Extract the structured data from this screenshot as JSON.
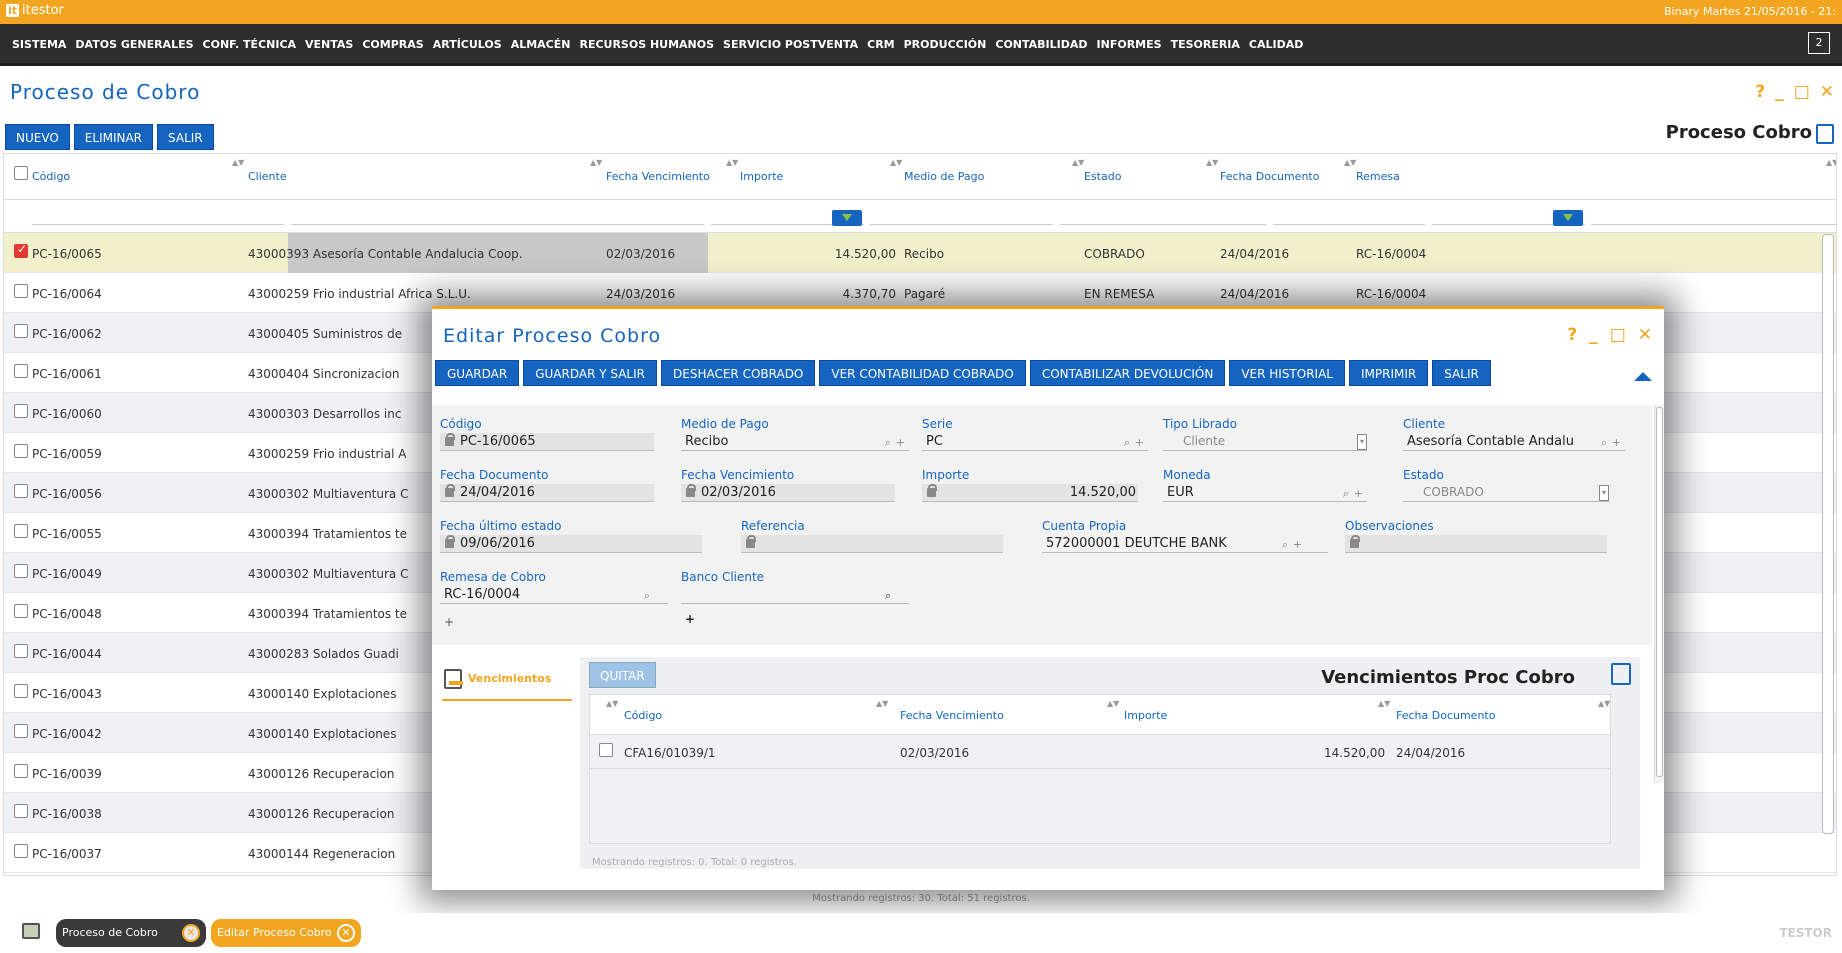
{
  "app": {
    "logo_mark": "it",
    "logo_name": "itestor",
    "top_right": "Binary Martes 21/05/2016 - 21:"
  },
  "menu": {
    "items": [
      "SISTEMA",
      "DATOS GENERALES",
      "CONF. TÉCNICA",
      "VENTAS",
      "COMPRAS",
      "ARTÍCULOS",
      "ALMACÉN",
      "RECURSOS HUMANOS",
      "SERVICIO POSTVENTA",
      "CRM",
      "PRODUCCIÓN",
      "CONTABILIDAD",
      "INFORMES",
      "TESORERIA",
      "CALIDAD"
    ],
    "badge": "2"
  },
  "page": {
    "title": "Proceso de Cobro",
    "section_title": "Proceso Cobro"
  },
  "window_icons": {
    "help": "?",
    "minimize": "_",
    "maximize": "□",
    "close": "✕"
  },
  "toolbar": {
    "new": "NUEVO",
    "delete": "ELIMINAR",
    "exit": "SALIR"
  },
  "grid": {
    "columns": [
      "Código",
      "Cliente",
      "Fecha Vencimiento",
      "Importe",
      "Medio de Pago",
      "Estado",
      "Fecha Documento",
      "Remesa"
    ],
    "rows": [
      {
        "codigo": "PC-16/0065",
        "cliente": "43000393 Asesoría Contable Andalucia Coop.",
        "fecha_venc": "02/03/2016",
        "importe": "14.520,00",
        "medio": "Recibo",
        "estado": "COBRADO",
        "fecha_doc": "24/04/2016",
        "remesa": "RC-16/0004",
        "selected": true
      },
      {
        "codigo": "PC-16/0064",
        "cliente": "43000259 Frio industrial Africa S.L.U.",
        "fecha_venc": "24/03/2016",
        "importe": "4.370,70",
        "medio": "Pagaré",
        "estado": "EN REMESA",
        "fecha_doc": "24/04/2016",
        "remesa": "RC-16/0004"
      },
      {
        "codigo": "PC-16/0062",
        "cliente": "43000405 Suministros de"
      },
      {
        "codigo": "PC-16/0061",
        "cliente": "43000404 Sincronizacion"
      },
      {
        "codigo": "PC-16/0060",
        "cliente": "43000303 Desarrollos inc"
      },
      {
        "codigo": "PC-16/0059",
        "cliente": "43000259 Frio industrial A"
      },
      {
        "codigo": "PC-16/0056",
        "cliente": "43000302 Multiaventura C"
      },
      {
        "codigo": "PC-16/0055",
        "cliente": "43000394 Tratamientos te"
      },
      {
        "codigo": "PC-16/0049",
        "cliente": "43000302 Multiaventura C"
      },
      {
        "codigo": "PC-16/0048",
        "cliente": "43000394 Tratamientos te"
      },
      {
        "codigo": "PC-16/0044",
        "cliente": "43000283 Solados Guadi"
      },
      {
        "codigo": "PC-16/0043",
        "cliente": "43000140 Explotaciones"
      },
      {
        "codigo": "PC-16/0042",
        "cliente": "43000140 Explotaciones"
      },
      {
        "codigo": "PC-16/0039",
        "cliente": "43000126 Recuperacion"
      },
      {
        "codigo": "PC-16/0038",
        "cliente": "43000126 Recuperacion"
      },
      {
        "codigo": "PC-16/0037",
        "cliente": "43000144 Regeneracion"
      }
    ],
    "status": "Mostrando registros: 30. Total: 51 registros."
  },
  "modal": {
    "title": "Editar Proceso Cobro",
    "buttons": [
      "GUARDAR",
      "GUARDAR Y SALIR",
      "DESHACER COBRADO",
      "VER CONTABILIDAD COBRADO",
      "CONTABILIZAR DEVOLUCIÓN",
      "VER HISTORIAL",
      "IMPRIMIR",
      "SALIR"
    ],
    "fields": {
      "codigo": {
        "label": "Código",
        "value": "PC-16/0065"
      },
      "medio_pago": {
        "label": "Medio de Pago",
        "value": "Recibo"
      },
      "serie": {
        "label": "Serie",
        "value": "PC"
      },
      "tipo_librado": {
        "label": "Tipo Librado",
        "value": "Cliente"
      },
      "cliente": {
        "label": "Cliente",
        "value": "Asesoría Contable Andalu"
      },
      "fecha_documento": {
        "label": "Fecha Documento",
        "value": "24/04/2016"
      },
      "fecha_vencimiento": {
        "label": "Fecha Vencimiento",
        "value": "02/03/2016"
      },
      "importe": {
        "label": "Importe",
        "value": "14.520,00"
      },
      "moneda": {
        "label": "Moneda",
        "value": "EUR"
      },
      "estado": {
        "label": "Estado",
        "value": "COBRADO"
      },
      "fecha_ultimo_estado": {
        "label": "Fecha último estado",
        "value": "09/06/2016"
      },
      "referencia": {
        "label": "Referencia",
        "value": ""
      },
      "cuenta_propia": {
        "label": "Cuenta Propia",
        "value": "572000001 DEUTCHE BANK"
      },
      "observaciones": {
        "label": "Observaciones",
        "value": ""
      },
      "remesa_cobro": {
        "label": "Remesa de Cobro",
        "value": "RC-16/0004"
      },
      "banco_cliente": {
        "label": "Banco Cliente",
        "value": ""
      }
    },
    "subtab": "Vencimientos",
    "sub": {
      "quitar": "QUITAR",
      "title": "Vencimientos Proc Cobro",
      "columns": [
        "Código",
        "Fecha Vencimiento",
        "Importe",
        "Fecha Documento"
      ],
      "rows": [
        {
          "codigo": "CFA16/01039/1",
          "fecha_venc": "02/03/2016",
          "importe": "14.520,00",
          "fecha_doc": "24/04/2016"
        }
      ],
      "status": "Mostrando registros: 0. Total: 0 registros."
    }
  },
  "taskbar": {
    "tab1": "Proceso de Cobro",
    "tab2": "Editar Proceso Cobro",
    "user": "TESTOR",
    "close": "✕"
  }
}
